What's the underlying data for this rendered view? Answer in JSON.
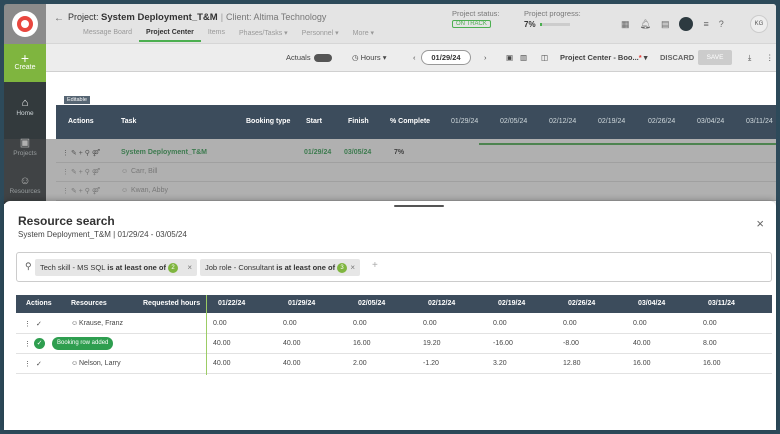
{
  "nav": {
    "create": "Create",
    "items": [
      "Home",
      "Projects",
      "Resources"
    ]
  },
  "header": {
    "project_prefix": "Project:",
    "project_name": "System Deployment_T&M",
    "client": "Client: Altima Technology",
    "tabs": [
      "Message Board",
      "Project Center",
      "Items",
      "Phases/Tasks ▾",
      "Personnel ▾",
      "More ▾"
    ],
    "status_label": "Project status:",
    "status_value": "ON TRACK",
    "progress_label": "Project progress:",
    "progress_value": "7%",
    "progress_fraction": 0.07,
    "avatar": "KG"
  },
  "toolbar": {
    "actuals": "Actuals",
    "actuals_toggle": "OFF",
    "hours": "Hours ▾",
    "prev": "‹",
    "date": "01/29/24",
    "next": "›",
    "view": "Project Center - Boo...",
    "view_mark": "*",
    "discard": "DISCARD",
    "save": "SAVE"
  },
  "grid": {
    "editable_tag": "Editable",
    "headers": [
      "Actions",
      "Task",
      "Booking type",
      "Start",
      "Finish",
      "% Complete"
    ],
    "dates": [
      "01/29/24",
      "02/05/24",
      "02/12/24",
      "02/19/24",
      "02/26/24",
      "03/04/24",
      "03/11/24"
    ],
    "rows": [
      {
        "task": "System Deployment_T&M",
        "start": "01/29/24",
        "finish": "03/05/24",
        "pct": "7%"
      },
      {
        "task": "Carr, Bill"
      },
      {
        "task": "Kwan, Abby"
      }
    ]
  },
  "sheet": {
    "title": "Resource search",
    "subtitle": "System Deployment_T&M | 01/29/24 - 03/05/24",
    "filters": [
      {
        "field": "Tech skill - MS SQL",
        "op": "is at least one of",
        "count": "2"
      },
      {
        "field": "Job role - Consultant",
        "op": "is at least one of",
        "count": "3"
      }
    ],
    "add_filter": "+",
    "close": "×"
  },
  "results": {
    "headers": [
      "Actions",
      "Resources",
      "Requested hours"
    ],
    "dates": [
      "01/22/24",
      "01/29/24",
      "02/05/24",
      "02/12/24",
      "02/19/24",
      "02/26/24",
      "03/04/24",
      "03/11/24"
    ],
    "rows": [
      {
        "resource": "Krause, Franz",
        "values": [
          "0.00",
          "0.00",
          "0.00",
          "0.00",
          "0.00",
          "0.00",
          "0.00",
          "0.00"
        ]
      },
      {
        "badge": "Booking row added",
        "values": [
          "40.00",
          "40.00",
          "16.00",
          "19.20",
          "-16.00",
          "-8.00",
          "40.00",
          "8.00"
        ]
      },
      {
        "resource": "Nelson, Larry",
        "values": [
          "40.00",
          "40.00",
          "2.00",
          "-1.20",
          "3.20",
          "12.80",
          "16.00",
          "16.00"
        ]
      }
    ]
  }
}
